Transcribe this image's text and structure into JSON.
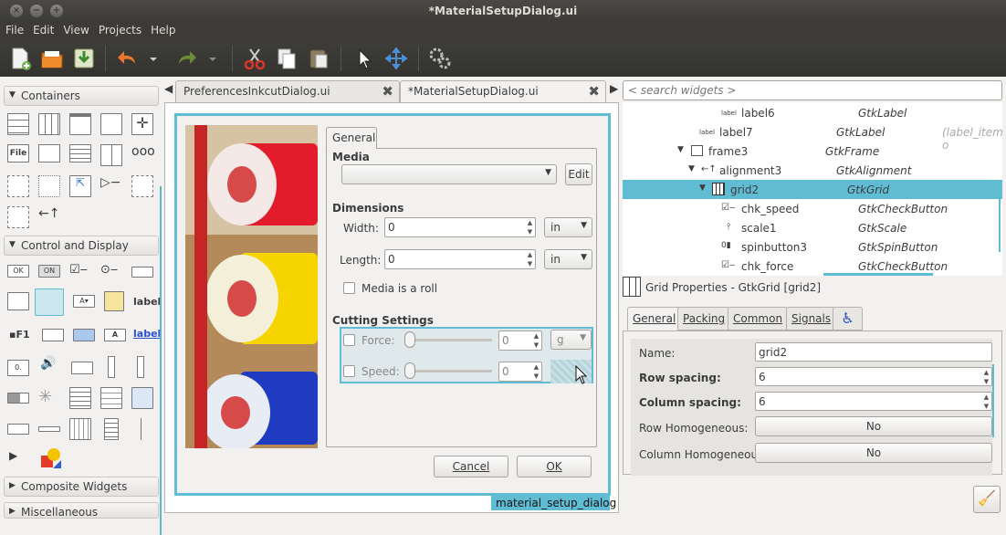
{
  "window": {
    "title": "*MaterialSetupDialog.ui"
  },
  "menu": {
    "file": "File",
    "edit": "Edit",
    "view": "View",
    "projects": "Projects",
    "help": "Help"
  },
  "palette": {
    "containers": "Containers",
    "control_display": "Control and Display",
    "composite": "Composite Widgets",
    "misc": "Miscellaneous",
    "file_label": "File",
    "ok_label": "OK",
    "on_label": "ON",
    "f1_label": "F1",
    "label_text": "label",
    "label_link": "label",
    "a_label": "A"
  },
  "tabs": [
    {
      "label": "PreferencesInkcutDialog.ui"
    },
    {
      "label": "*MaterialSetupDialog.ui"
    }
  ],
  "dialog": {
    "name_tag": "material_setup_dialog",
    "notebook_tab": "General",
    "media_heading": "Media",
    "media_value": "",
    "edit_button": "Edit",
    "dimensions_heading": "Dimensions",
    "width_label": "Width:",
    "width_value": "0",
    "width_unit": "in",
    "length_label": "Length:",
    "length_value": "0",
    "length_unit": "in",
    "roll_label": "Media is a roll",
    "cutting_heading": "Cutting Settings",
    "force_label": "Force:",
    "force_value": "0",
    "force_unit": "g",
    "speed_label": "Speed:",
    "speed_value": "0",
    "cancel_button": "Cancel",
    "ok_button": "OK"
  },
  "search": {
    "placeholder": "< search widgets >"
  },
  "tree": [
    {
      "name": "label6",
      "class": "GtkLabel",
      "extra": ""
    },
    {
      "name": "label7",
      "class": "GtkLabel",
      "extra": "(label_item o"
    },
    {
      "name": "frame3",
      "class": "GtkFrame",
      "extra": ""
    },
    {
      "name": "alignment3",
      "class": "GtkAlignment",
      "extra": ""
    },
    {
      "name": "grid2",
      "class": "GtkGrid",
      "extra": ""
    },
    {
      "name": "chk_speed",
      "class": "GtkCheckButton",
      "extra": ""
    },
    {
      "name": "scale1",
      "class": "GtkScale",
      "extra": ""
    },
    {
      "name": "spinbutton3",
      "class": "GtkSpinButton",
      "extra": ""
    },
    {
      "name": "chk_force",
      "class": "GtkCheckButton",
      "extra": ""
    }
  ],
  "properties": {
    "title": "Grid Properties - GtkGrid [grid2]",
    "tabs": [
      "General",
      "Packing",
      "Common",
      "Signals"
    ],
    "rows": [
      {
        "label": "Name:",
        "value": "grid2"
      },
      {
        "label": "Row spacing:",
        "value": "6"
      },
      {
        "label": "Column spacing:",
        "value": "6"
      },
      {
        "label": "Row Homogeneous:",
        "value": "No"
      },
      {
        "label": "Column Homogeneous:",
        "value": "No"
      }
    ]
  },
  "colors": {
    "accent": "#5fbcd3",
    "titlebar": "#3c3b37",
    "background": "#f2f1f0"
  }
}
